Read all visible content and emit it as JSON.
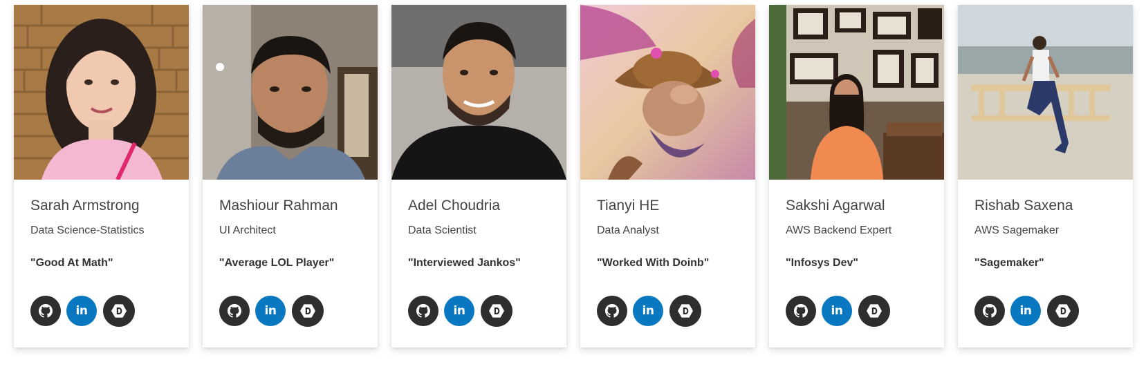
{
  "members": [
    {
      "name": "Sarah Armstrong",
      "role": "Data Science-Statistics",
      "quote": "\"Good At Math\"",
      "photo_icon": "portrait-photo"
    },
    {
      "name": "Mashiour Rahman",
      "role": "UI Architect",
      "quote": "\"Average LOL Player\"",
      "photo_icon": "portrait-photo"
    },
    {
      "name": "Adel Choudria",
      "role": "Data Scientist",
      "quote": "\"Interviewed Jankos\"",
      "photo_icon": "portrait-photo"
    },
    {
      "name": "Tianyi HE",
      "role": "Data Analyst",
      "quote": "\"Worked With Doinb\"",
      "photo_icon": "game-character-artwork"
    },
    {
      "name": "Sakshi Agarwal",
      "role": "AWS Backend Expert",
      "quote": "\"Infosys Dev\"",
      "photo_icon": "portrait-photo"
    },
    {
      "name": "Rishab Saxena",
      "role": "AWS Sagemaker",
      "quote": "\"Sagemaker\"",
      "photo_icon": "portrait-photo"
    }
  ],
  "social_icons": [
    "github-icon",
    "linkedin-icon",
    "devpost-icon"
  ],
  "social_labels": {
    "linkedin": "in"
  },
  "colors": {
    "icon_dark": "#2e2e2e",
    "linkedin_blue": "#0a78c0",
    "card_bg": "#ffffff"
  }
}
